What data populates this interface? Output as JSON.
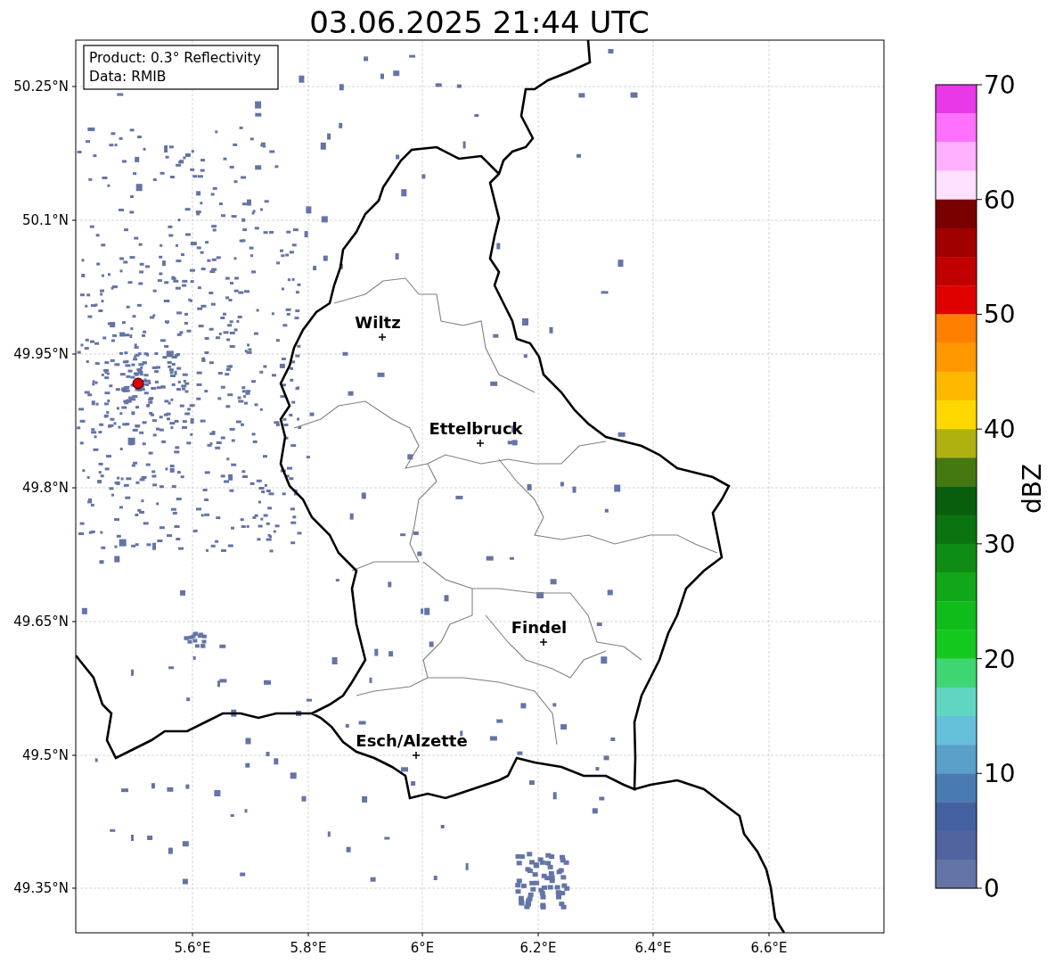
{
  "title": "03.06.2025 21:44 UTC",
  "info_box": {
    "lines": [
      "Product: 0.3° Reflectivity",
      "Data: RMIB"
    ]
  },
  "lat_ticks": [
    "50.25°N",
    "50.1°N",
    "49.95°N",
    "49.8°N",
    "49.65°N",
    "49.5°N",
    "49.35°N"
  ],
  "lon_ticks": [
    "5.6°E",
    "5.8°E",
    "6°E",
    "6.2°E",
    "6.4°E",
    "6.6°E"
  ],
  "cities": [
    {
      "name": "Wiltz"
    },
    {
      "name": "Ettelbruck"
    },
    {
      "name": "Findel"
    },
    {
      "name": "Esch/Alzette"
    }
  ],
  "colorbar": {
    "label": "dBZ",
    "ticks": [
      "70",
      "60",
      "50",
      "40",
      "30",
      "20",
      "10",
      "0"
    ],
    "segments": [
      {
        "color": "#e838e8"
      },
      {
        "color": "#ff70ff"
      },
      {
        "color": "#ffb0ff"
      },
      {
        "color": "#ffe0ff"
      },
      {
        "color": "#780000"
      },
      {
        "color": "#a00000"
      },
      {
        "color": "#c00000"
      },
      {
        "color": "#e00000"
      },
      {
        "color": "#ff8000"
      },
      {
        "color": "#ff9800"
      },
      {
        "color": "#ffb800"
      },
      {
        "color": "#ffd800"
      },
      {
        "color": "#b0b010"
      },
      {
        "color": "#447810"
      },
      {
        "color": "#085e0c"
      },
      {
        "color": "#0b7410"
      },
      {
        "color": "#0e8c14"
      },
      {
        "color": "#10a818"
      },
      {
        "color": "#10bc1a"
      },
      {
        "color": "#14c81e"
      },
      {
        "color": "#3dd672"
      },
      {
        "color": "#60d6c0"
      },
      {
        "color": "#65c0da"
      },
      {
        "color": "#5aa0c8"
      },
      {
        "color": "#4a7ab2"
      },
      {
        "color": "#4360a0"
      },
      {
        "color": "#5264a0"
      },
      {
        "color": "#6474a6"
      }
    ]
  }
}
